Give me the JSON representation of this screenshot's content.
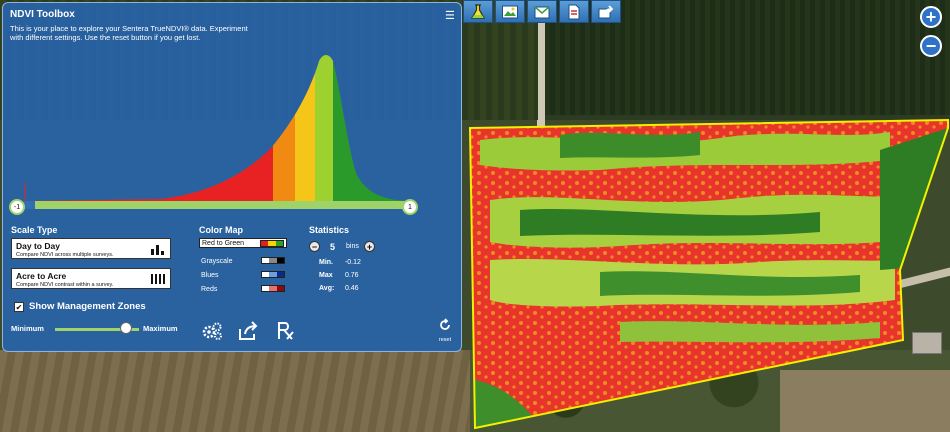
{
  "toolbox": {
    "title": "NDVI Toolbox",
    "description": "This is your place to explore your Sentera TrueNDVI® data. Experiment with different settings. Use the reset button if you get lost.",
    "menu_icon": "hamburger-menu-icon",
    "histogram": {
      "min_label": "-1",
      "max_label": "1"
    },
    "scale_type": {
      "heading": "Scale Type",
      "options": [
        {
          "name": "Day to Day",
          "subtitle": "Compare NDVI across multiple surveys.",
          "icon": "bar-chart-icon",
          "selected": true
        },
        {
          "name": "Acre to Acre",
          "subtitle": "Compare NDVI contrast within a survey.",
          "icon": "barcode-icon",
          "selected": false
        }
      ]
    },
    "color_map": {
      "heading": "Color Map",
      "options": [
        {
          "name": "Red to Green",
          "selected": true,
          "colors": [
            "#e02020",
            "#f5d400",
            "#2ba02b"
          ]
        },
        {
          "name": "Grayscale",
          "selected": false,
          "colors": [
            "#ffffff",
            "#888888",
            "#000000"
          ]
        },
        {
          "name": "Blues",
          "selected": false,
          "colors": [
            "#ffffff",
            "#6aa0e0",
            "#0b2b8a"
          ]
        },
        {
          "name": "Reds",
          "selected": false,
          "colors": [
            "#ffffff",
            "#e87070",
            "#8a0b0b"
          ]
        }
      ]
    },
    "statistics": {
      "heading": "Statistics",
      "bins_value": "5",
      "bins_label": "bins",
      "min_label": "Min.",
      "min_value": "-0.12",
      "max_label": "Max",
      "max_value": "0.76",
      "avg_label": "Avg:",
      "avg_value": "0.46"
    },
    "management_zones": {
      "label": "Show Management Zones",
      "checked": true,
      "minimum_label": "Minimum",
      "maximum_label": "Maximum",
      "slider_value": 0.85
    },
    "actions": {
      "settings_icon": "gears-icon",
      "share_icon": "share-icon",
      "prescription_icon": "prescription-icon",
      "reset_label": "reset"
    }
  },
  "toolbar": {
    "icons": [
      "flask-icon",
      "image-icon",
      "map-export-icon",
      "pdf-icon",
      "share-export-icon"
    ],
    "accent": "#2f73c9"
  },
  "zoom": {
    "in_label": "+",
    "out_label": "−"
  }
}
